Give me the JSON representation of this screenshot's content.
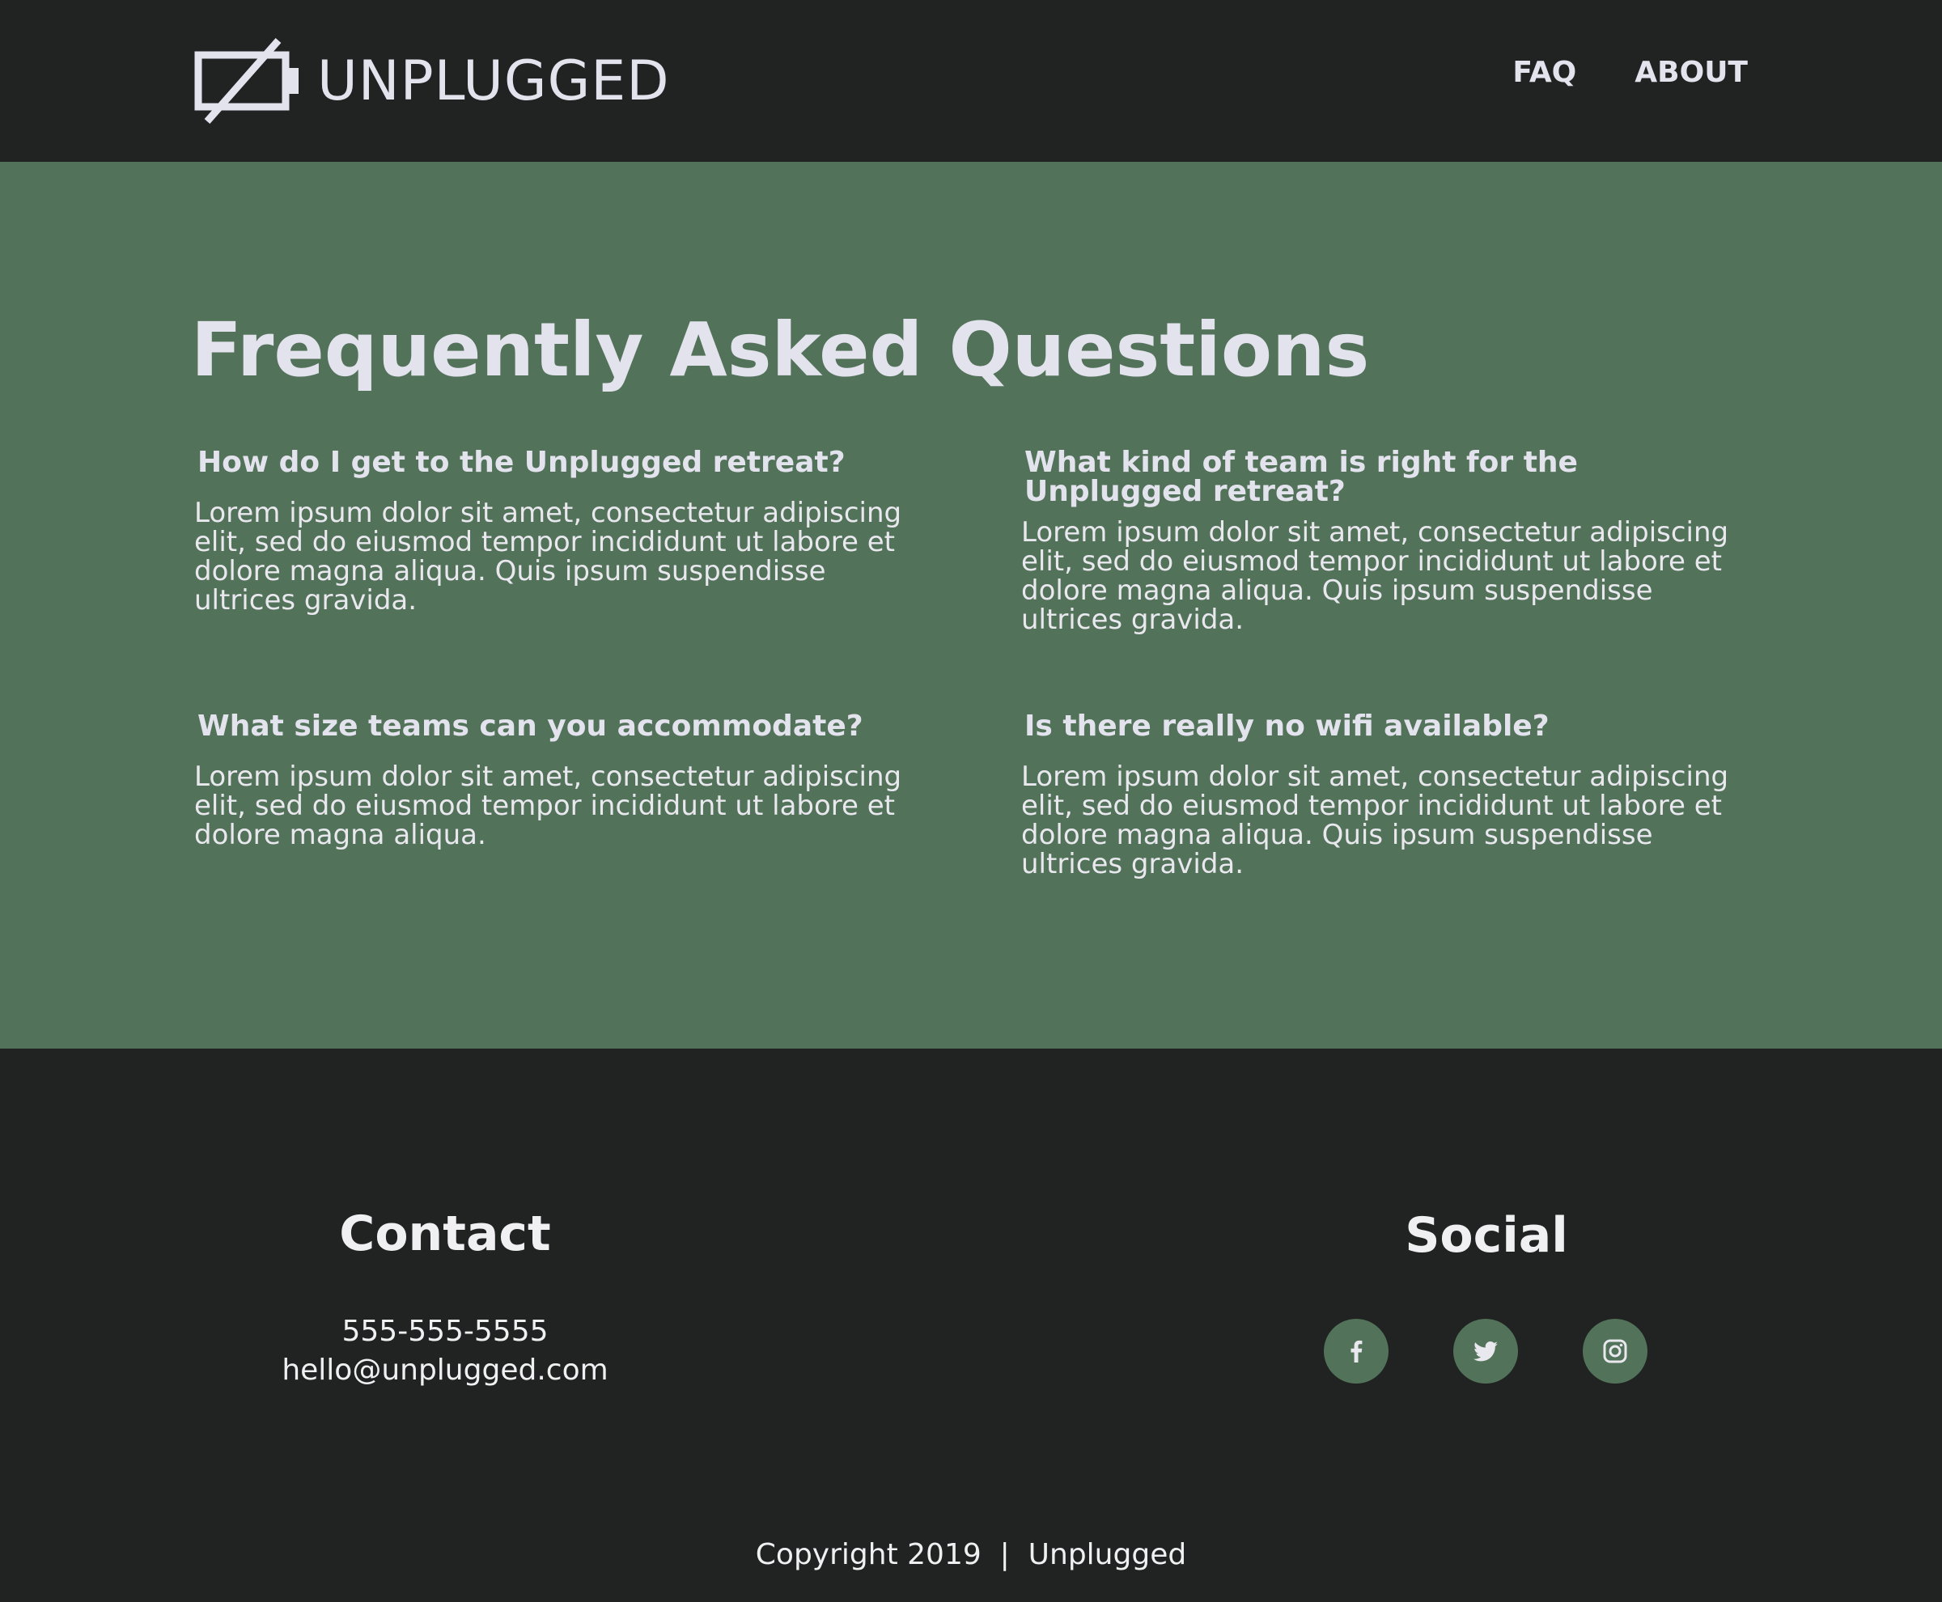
{
  "header": {
    "brand": "UNPLUGGED",
    "logo_icon": "unplugged-battery-icon",
    "nav": [
      {
        "label": "FAQ"
      },
      {
        "label": "ABOUT"
      }
    ]
  },
  "faq": {
    "title": "Frequently Asked Questions",
    "items": [
      {
        "question": "How do I get to the Unplugged retreat?",
        "answer": "Lorem ipsum dolor sit amet, consectetur adipiscing elit, sed do eiusmod tempor incididunt ut labore et dolore magna aliqua. Quis ipsum suspendisse ultrices gravida."
      },
      {
        "question": "What kind of team is right for the Unplugged retreat?",
        "answer": "Lorem ipsum dolor sit amet, consectetur adipiscing elit, sed do eiusmod tempor incididunt ut labore et dolore magna aliqua. Quis ipsum suspendisse ultrices gravida."
      },
      {
        "question": "What size teams can you accommodate?",
        "answer": "Lorem ipsum dolor sit amet, consectetur adipiscing elit, sed do eiusmod tempor incididunt ut labore et dolore magna aliqua."
      },
      {
        "question": "Is there really no wifi available?",
        "answer": "Lorem ipsum dolor sit amet, consectetur adipiscing elit, sed do eiusmod tempor incididunt ut labore et dolore magna aliqua. Quis ipsum suspendisse ultrices gravida."
      }
    ]
  },
  "footer": {
    "contact": {
      "heading": "Contact",
      "phone": "555-555-5555",
      "email": "hello@unplugged.com"
    },
    "social": {
      "heading": "Social",
      "icons": [
        "facebook-icon",
        "twitter-icon",
        "instagram-icon"
      ]
    },
    "copyright": "Copyright 2019  |  Unplugged"
  },
  "colors": {
    "dark": "#212322",
    "green": "#53725a",
    "text": "#e3e3ee"
  }
}
